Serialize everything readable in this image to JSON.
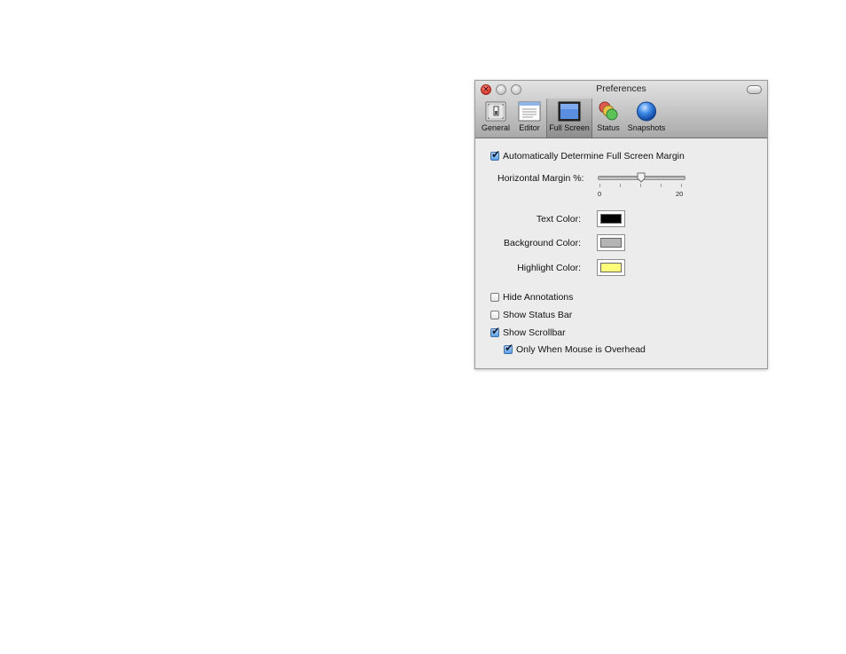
{
  "window": {
    "title": "Preferences"
  },
  "toolbar": {
    "items": [
      {
        "label": "General",
        "icon": "general-switch-icon"
      },
      {
        "label": "Editor",
        "icon": "editor-window-icon"
      },
      {
        "label": "Full Screen",
        "icon": "full-screen-icon",
        "selected": true
      },
      {
        "label": "Status",
        "icon": "status-traffic-lights-icon"
      },
      {
        "label": "Snapshots",
        "icon": "snapshots-blue-sphere-icon"
      }
    ]
  },
  "fullscreen": {
    "auto_margin": {
      "label": "Automatically Determine Full Screen Margin",
      "checked": true
    },
    "horizontal_margin": {
      "label": "Horizontal Margin %:",
      "min_label": "0",
      "max_label": "20",
      "value_fraction": 0.5
    },
    "text_color": {
      "label": "Text Color:",
      "color": "#000000"
    },
    "background_color": {
      "label": "Background Color:",
      "color": "#b4b4b4"
    },
    "highlight_color": {
      "label": "Highlight Color:",
      "color": "#ffff7a"
    },
    "hide_annotations": {
      "label": "Hide Annotations",
      "checked": false
    },
    "show_status_bar": {
      "label": "Show Status Bar",
      "checked": false
    },
    "show_scrollbar": {
      "label": "Show Scrollbar",
      "checked": true
    },
    "only_when_mouse_overhead": {
      "label": "Only When Mouse is Overhead",
      "checked": true
    }
  }
}
